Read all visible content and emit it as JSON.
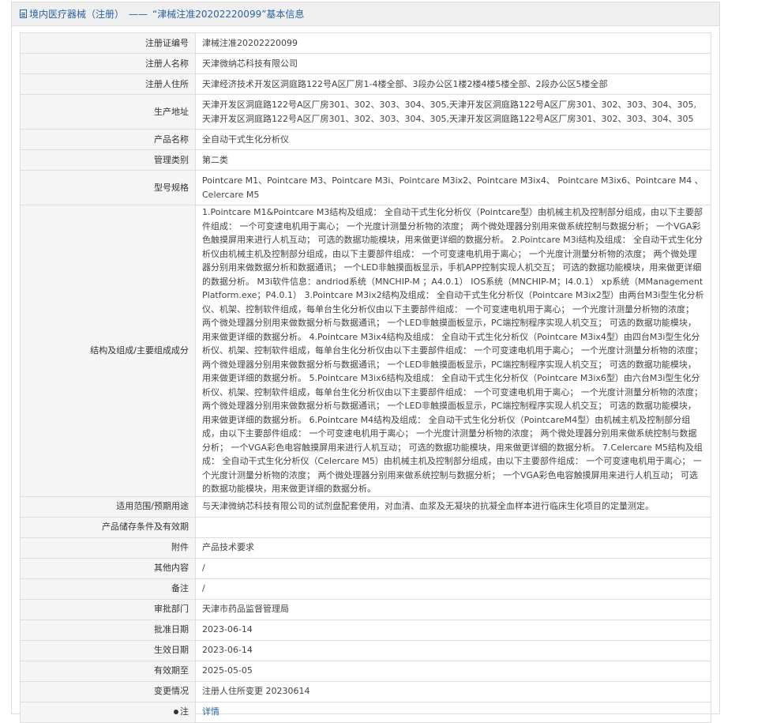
{
  "header": {
    "category": "境内医疗器械（注册）",
    "separator": "——",
    "title": "“津械注准20202220099”基本信息"
  },
  "rows": [
    {
      "label": "注册证编号",
      "value": "津械注准20202220099"
    },
    {
      "label": "注册人名称",
      "value": "天津微纳芯科技有限公司"
    },
    {
      "label": "注册人住所",
      "value": "天津经济技术开发区洞庭路122号A区厂房1-4楼全部、3段办公区1楼2楼4楼5楼全部、2段办公区5楼全部"
    },
    {
      "label": "生产地址",
      "value": "天津开发区洞庭路122号A区厂房301、302、303、304、305,天津开发区洞庭路122号A区厂房301、302、303、304、305,天津开发区洞庭路122号A区厂房301、302、303、304、305,天津开发区洞庭路122号A区厂房301、302、303、304、305"
    },
    {
      "label": "产品名称",
      "value": "全自动干式生化分析仪"
    },
    {
      "label": "管理类别",
      "value": "第二类"
    },
    {
      "label": "型号规格",
      "value": "Pointcare M1、Pointcare M3、Pointcare M3i、Pointcare M3ix2、Pointcare M3ix4、 Pointcare M3ix6、Pointcare M4 、Celercare M5"
    },
    {
      "label": "结构及组成/主要组成成分",
      "value": "1.Pointcare M1&Pointcare M3结构及组成： 全自动干式生化分析仪（Pointcare型）由机械主机及控制部分组成，由以下主要部件组成： 一个可变速电机用于离心； 一个光度计测量分析物的浓度； 两个微处理器分别用来做系统控制与数据分析； 一个VGA彩色触摸屏用来进行人机互动； 可选的数据功能模块，用来做更详细的数据分析。 2.Pointcare M3i结构及组成： 全自动干式生化分析仪由机械主机及控制部分组成，由以下主要部件组成： 一个可变速电机用于离心； 一个光度计测量分析物的浓度； 两个微处理器分别用来做数据分析和数据通讯； 一个LED非触摸面板显示，手机APP控制实现人机交互； 可选的数据功能模块，用来做更详细的数据分析。 M3i软件信息：andriod系统（MNCHIP-M ；A4.0.1） IOS系统（MNCHIP-M；I4.0.1） xp系统（MManagementPlatform.exe；P4.0.1） 3.Pointcare M3ix2结构及组成： 全自动干式生化分析仪（Pointcare M3ix2型）由两台M3i型生化分析仪、机架、控制软件组成，每单台生化分析仪由以下主要部件组成： 一个可变速电机用于离心； 一个光度计测量分析物的浓度； 两个微处理器分别用来做数据分析与数据通讯； 一个LED非触摸面板显示，PC端控制程序实现人机交互； 可选的数据功能模块，用来做更详细的数据分析。 4.Pointcare M3ix4结构及组成： 全自动干式生化分析仪（Pointcare M3ix4型）由四台M3i型生化分析仪、机架、控制软件组成，每单台生化分析仪由以下主要部件组成： 一个可变速电机用于离心； 一个光度计测量分析物的浓度； 两个微处理器分别用来做数据分析与数据通讯； 一个LED非触摸面板显示，PC端控制程序实现人机交互； 可选的数据功能模块，用来做更详细的数据分析。 5.Pointcare M3ix6结构及组成： 全自动干式生化分析仪（Pointcare M3ix6型）由六台M3i型生化分析仪、机架、控制软件组成，每单台生化分析仪由以下主要部件组成： 一个可变速电机用于离心； 一个光度计测量分析物的浓度； 两个微处理器分别用来做数据分析与数据通讯； 一个LED非触摸面板显示，PC端控制程序实现人机交互； 可选的数据功能模块，用来做更详细的数据分析。 6.Pointcare M4结构及组成： 全自动干式生化分析仪（PointcareM4型）由机械主机及控制部分组成，由以下主要部件组成： 一个可变速电机用于离心； 一个光度计测量分析物的浓度； 两个微处理器分别用来做系统控制与数据分析； 一个VGA彩色电容触摸屏用来进行人机互动； 可选的数据功能模块，用来做更详细的数据分析。 7.Celercare M5结构及组成： 全自动干式生化分析仪（Celercare M5）由机械主机及控制部分组成，由以下主要部件组成： 一个可变速电机用于离心； 一个光度计测量分析物的浓度； 两个微处理器分别用来做系统控制与数据分析； 一个VGA彩色电容触摸屏用来进行人机互动； 可选的数据功能模块，用来做更详细的数据分析。"
    },
    {
      "label": "适用范围/预期用途",
      "value": "与天津微纳芯科技有限公司的试剂盘配套使用，对血清、血浆及无凝块的抗凝全血样本进行临床生化项目的定量测定。"
    },
    {
      "label": "产品储存条件及有效期",
      "value": ""
    },
    {
      "label": "附件",
      "value": "产品技术要求"
    },
    {
      "label": "其他内容",
      "value": "/"
    },
    {
      "label": "备注",
      "value": "/"
    },
    {
      "label": "审批部门",
      "value": "天津市药品监督管理局"
    },
    {
      "label": "批准日期",
      "value": "2023-06-14"
    },
    {
      "label": "生效日期",
      "value": "2023-06-14"
    },
    {
      "label": "有效期至",
      "value": "2025-05-05"
    },
    {
      "label": "变更情况",
      "value": "注册人住所变更 20230614"
    },
    {
      "label": "注",
      "value": "详情"
    }
  ]
}
